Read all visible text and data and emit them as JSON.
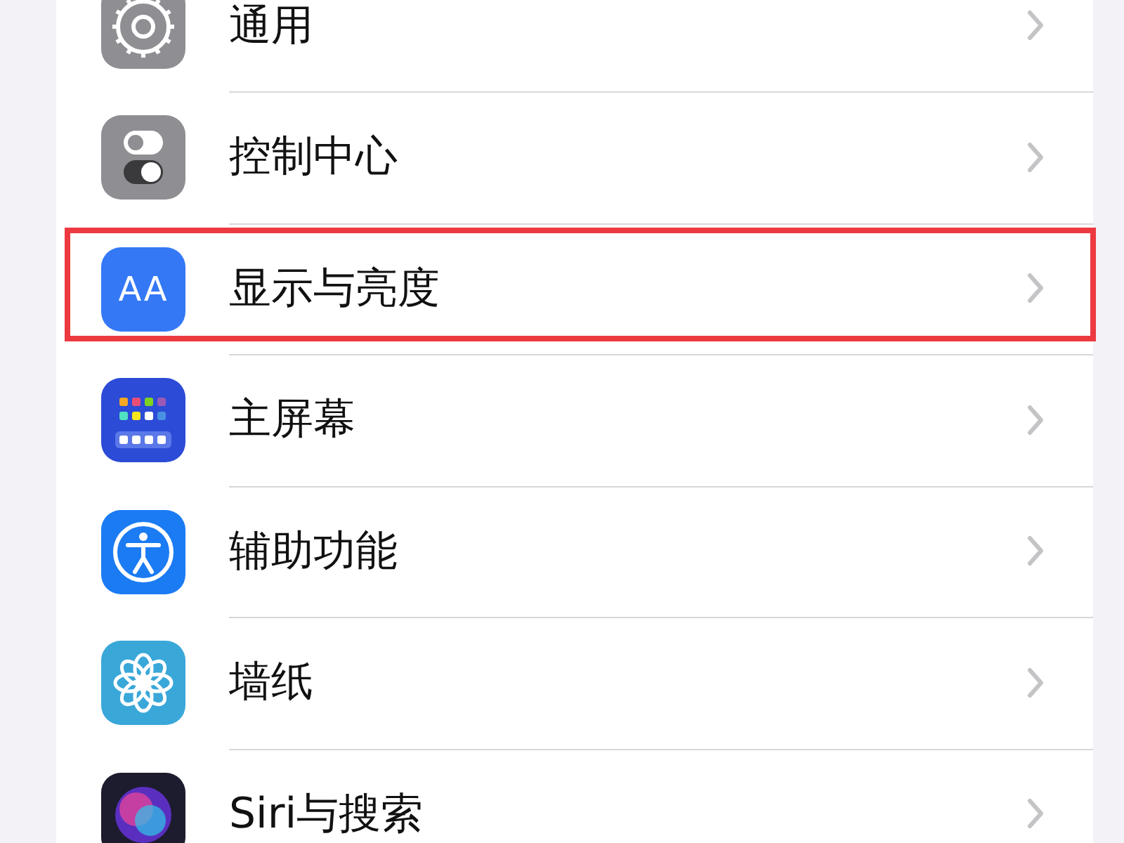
{
  "settings_list": [
    {
      "label": "通用",
      "kind": "gear",
      "highlighted": false
    },
    {
      "label": "控制中心",
      "kind": "toggles",
      "highlighted": false
    },
    {
      "label": "显示与亮度",
      "kind": "text-size",
      "glyph": "AA",
      "highlighted": true
    },
    {
      "label": "主屏幕",
      "kind": "home-grid",
      "highlighted": false
    },
    {
      "label": "辅助功能",
      "kind": "accessibility",
      "highlighted": false
    },
    {
      "label": "墙纸",
      "kind": "flower",
      "highlighted": false
    },
    {
      "label": "Siri与搜索",
      "kind": "siri",
      "highlighted": false
    }
  ]
}
